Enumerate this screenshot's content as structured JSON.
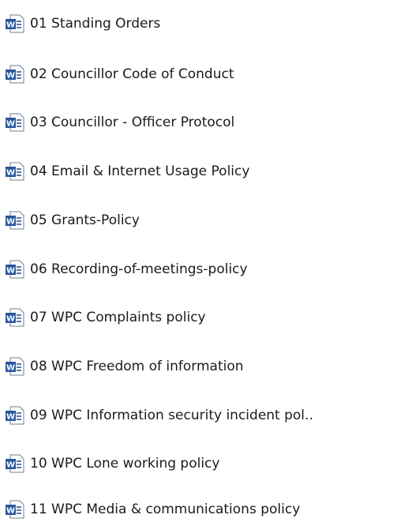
{
  "files": [
    {
      "name": "01 Standing Orders",
      "icon": "word-document-icon"
    },
    {
      "name": "02 Councillor Code of Conduct",
      "icon": "word-document-icon"
    },
    {
      "name": "03 Councillor - Officer Protocol",
      "icon": "word-document-icon"
    },
    {
      "name": "04 Email & Internet Usage Policy",
      "icon": "word-document-icon"
    },
    {
      "name": "05 Grants-Policy",
      "icon": "word-document-icon"
    },
    {
      "name": "06 Recording-of-meetings-policy",
      "icon": "word-document-icon"
    },
    {
      "name": "07 WPC Complaints policy",
      "icon": "word-document-icon"
    },
    {
      "name": "08 WPC Freedom of information",
      "icon": "word-document-icon"
    },
    {
      "name": "09 WPC Information security incident pol..",
      "icon": "word-document-icon"
    },
    {
      "name": "10 WPC Lone working policy",
      "icon": "word-document-icon"
    },
    {
      "name": "11 WPC Media & communications policy",
      "icon": "word-document-icon"
    }
  ],
  "colors": {
    "icon_blue": "#2b579a",
    "icon_page": "#ffffff",
    "icon_border": "#6f7f95",
    "text": "#1a1a1a"
  }
}
